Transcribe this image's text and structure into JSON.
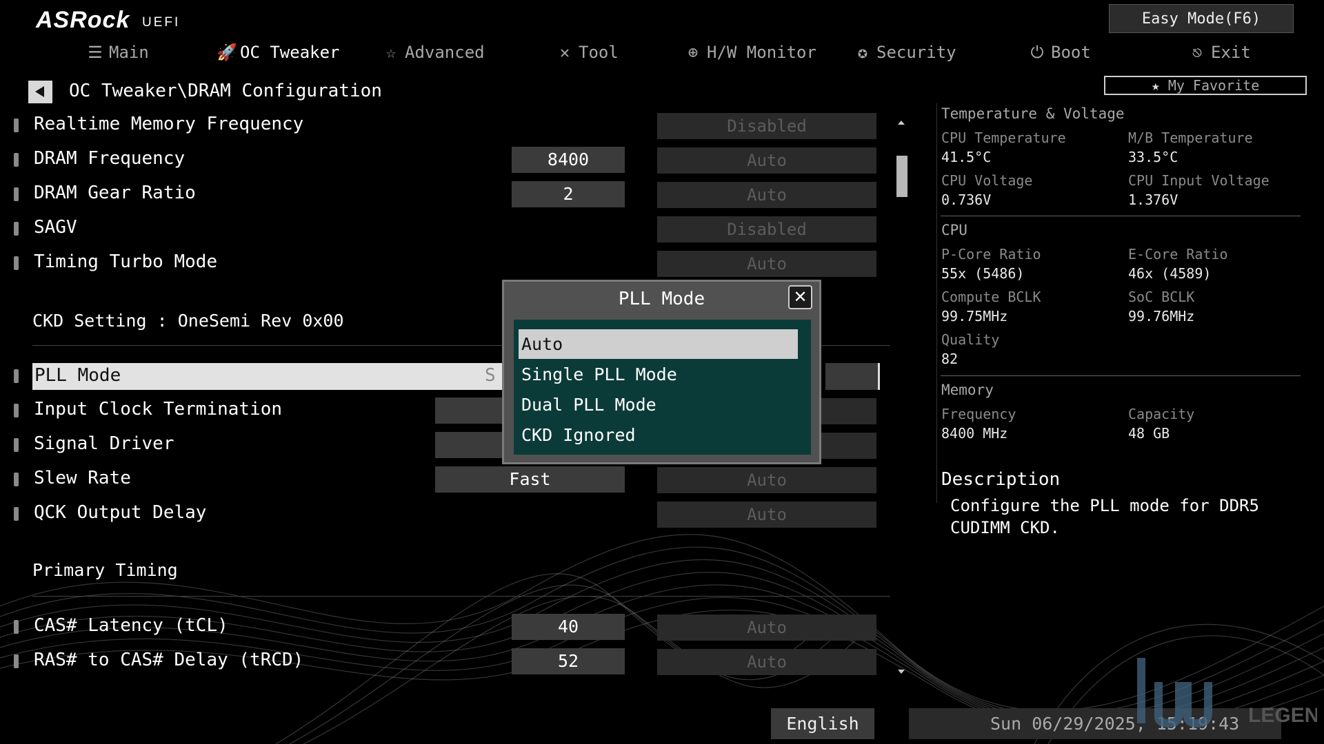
{
  "header": {
    "brand": "ASRock",
    "brand_sub": "UEFI",
    "easy_mode": "Easy Mode(F6)",
    "my_favorite": "My Favorite",
    "tabs": [
      {
        "label": "Main",
        "icon": "list-icon"
      },
      {
        "label": "OC Tweaker",
        "icon": "rocket-icon"
      },
      {
        "label": "Advanced",
        "icon": "star-icon"
      },
      {
        "label": "Tool",
        "icon": "tools-icon"
      },
      {
        "label": "H/W Monitor",
        "icon": "crosshair-icon"
      },
      {
        "label": "Security",
        "icon": "shield-icon"
      },
      {
        "label": "Boot",
        "icon": "power-icon"
      },
      {
        "label": "Exit",
        "icon": "exit-icon"
      }
    ]
  },
  "breadcrumb": "OC Tweaker\\DRAM Configuration",
  "settings": {
    "realtime_mem": {
      "label": "Realtime Memory Frequency",
      "option": "Disabled"
    },
    "dram_freq": {
      "label": "DRAM Frequency",
      "value": "8400",
      "option": "Auto"
    },
    "dram_gear": {
      "label": "DRAM Gear Ratio",
      "value": "2",
      "option": "Auto"
    },
    "sagv": {
      "label": "SAGV",
      "option": "Disabled"
    },
    "timing_turbo": {
      "label": "Timing Turbo Mode",
      "option": "Auto"
    },
    "ckd_setting": "CKD Setting : OneSemi Rev 0x00",
    "pll_mode": {
      "label": "PLL Mode",
      "value_glimpse": "S"
    },
    "input_clock": {
      "label": "Input Clock Termination"
    },
    "signal_driver": {
      "label": "Signal Driver"
    },
    "slew_rate": {
      "label": "Slew Rate",
      "value": "Fast",
      "option": "Auto"
    },
    "qck_delay": {
      "label": "QCK Output Delay",
      "option": "Auto"
    },
    "primary_timing": "Primary Timing",
    "cas_latency": {
      "label": "CAS# Latency (tCL)",
      "value": "40",
      "option": "Auto"
    },
    "ras_cas": {
      "label": "RAS# to CAS# Delay (tRCD)",
      "value": "52",
      "option": "Auto"
    }
  },
  "popup": {
    "title": "PLL Mode",
    "options": [
      "Auto",
      "Single PLL Mode",
      "Dual PLL Mode",
      "CKD Ignored"
    ],
    "selected": "Auto"
  },
  "monitor": {
    "tv_title": "Temperature & Voltage",
    "cpu_temp_label": "CPU Temperature",
    "cpu_temp": "41.5°C",
    "mb_temp_label": "M/B Temperature",
    "mb_temp": "33.5°C",
    "cpu_volt_label": "CPU Voltage",
    "cpu_volt": "0.736V",
    "cpu_in_volt_label": "CPU Input Voltage",
    "cpu_in_volt": "1.376V",
    "cpu_title": "CPU",
    "pcore_label": "P-Core Ratio",
    "pcore": "55x (5486)",
    "ecore_label": "E-Core Ratio",
    "ecore": "46x (4589)",
    "compute_label": "Compute BCLK",
    "compute": "99.75MHz",
    "soc_label": "SoC BCLK",
    "soc": "99.76MHz",
    "quality_label": "Quality",
    "quality": "82",
    "mem_title": "Memory",
    "freq_label": "Frequency",
    "freq": "8400 MHz",
    "cap_label": "Capacity",
    "cap": "48 GB"
  },
  "description": {
    "title": "Description",
    "text": "Configure the PLL mode for DDR5 CUDIMM CKD."
  },
  "footer": {
    "language": "English",
    "datetime": "Sun 06/29/2025, 15:19:43",
    "watermark": "LEGEND"
  }
}
